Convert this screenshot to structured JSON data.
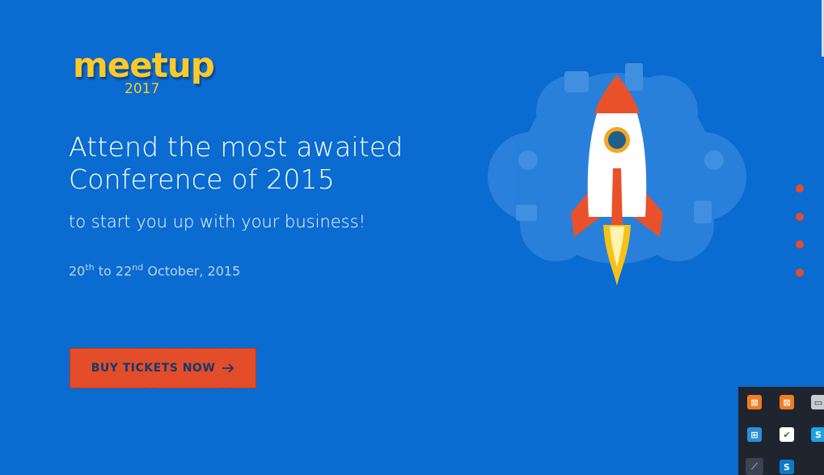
{
  "logo": {
    "word": "meetup",
    "year": "2017"
  },
  "hero": {
    "headline": "Attend the most awaited Conference of 2015",
    "subheadline": "to start you up with your business!",
    "dates": {
      "start_day": "20",
      "start_suffix": "th",
      "joiner": "to",
      "end_day": "22",
      "end_suffix": "nd",
      "month_year": "October, 2015"
    },
    "cta_label": "BUY TICKETS NOW"
  },
  "slider": {
    "dots": 4
  },
  "colors": {
    "background": "#0a6bd1",
    "accent": "#e44d2a",
    "logo": "#ffc928"
  },
  "icons": [
    "rocket-illustration",
    "arrow-right-icon",
    "xampp-icon",
    "xampp-icon",
    "monitor-icon",
    "network-icon",
    "shield-icon",
    "skype-icon",
    "feather-icon",
    "skype-business-icon"
  ]
}
